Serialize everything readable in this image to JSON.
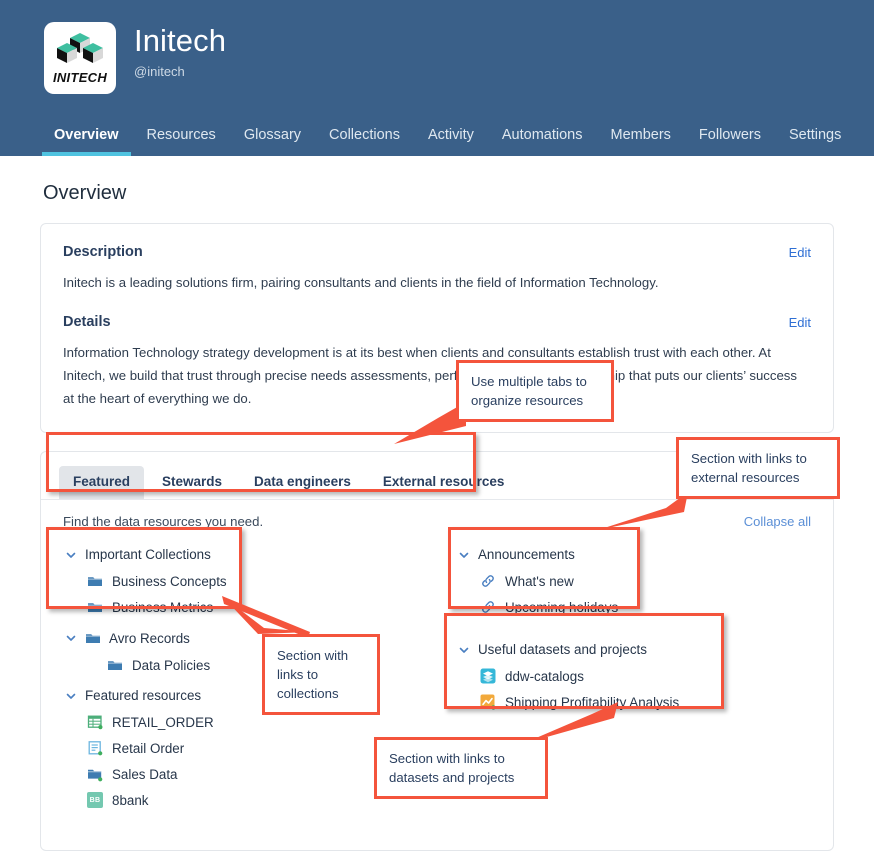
{
  "header": {
    "org_name": "Initech",
    "org_handle": "@initech",
    "logo_word": "INITECH",
    "nav": [
      {
        "label": "Overview",
        "active": true
      },
      {
        "label": "Resources",
        "active": false
      },
      {
        "label": "Glossary",
        "active": false
      },
      {
        "label": "Collections",
        "active": false
      },
      {
        "label": "Activity",
        "active": false
      },
      {
        "label": "Automations",
        "active": false
      },
      {
        "label": "Members",
        "active": false
      },
      {
        "label": "Followers",
        "active": false
      },
      {
        "label": "Settings",
        "active": false
      }
    ]
  },
  "page": {
    "title": "Overview"
  },
  "description": {
    "heading": "Description",
    "edit_label": "Edit",
    "body": "Initech is a leading solutions firm, pairing consultants and clients in the field of Information Technology."
  },
  "details": {
    "heading": "Details",
    "edit_label": "Edit",
    "body": "Information Technology strategy development is at its best when clients and consultants establish trust with each other. At Initech, we build that trust through precise needs assessments, performance in tu                        nd partnership that puts our clients’ success at the heart of everything we do."
  },
  "resources": {
    "tabs": [
      {
        "label": "Featured",
        "active": true
      },
      {
        "label": "Stewards",
        "active": false
      },
      {
        "label": "Data engineers",
        "active": false
      },
      {
        "label": "External resources",
        "active": false
      }
    ],
    "find_text": "Find the data resources you need.",
    "collapse_label": "Collapse all",
    "left_groups": [
      {
        "title": "Important Collections",
        "icon": "chevron-down-icon",
        "has_group_icon": false,
        "items": [
          {
            "label": "Business Concepts",
            "icon": "folder-icon"
          },
          {
            "label": "Business Metrics",
            "icon": "folder-icon"
          }
        ]
      },
      {
        "title": "Avro Records",
        "icon": "chevron-down-icon",
        "has_group_icon": true,
        "items": [
          {
            "label": "Data Policies",
            "icon": "folder-icon"
          }
        ]
      },
      {
        "title": "Featured resources",
        "icon": "chevron-down-icon",
        "has_group_icon": false,
        "items": [
          {
            "label": "RETAIL_ORDER",
            "icon": "table-icon"
          },
          {
            "label": "Retail Order",
            "icon": "document-icon"
          },
          {
            "label": "Sales Data",
            "icon": "folder-icon"
          },
          {
            "label": "8bank",
            "icon": "bb-badge-icon"
          }
        ]
      }
    ],
    "right_groups": [
      {
        "title": "Announcements",
        "icon": "chevron-down-icon",
        "items": [
          {
            "label": "What's new",
            "icon": "link-icon"
          },
          {
            "label": "Upcoming holidays",
            "icon": "link-icon"
          }
        ]
      },
      {
        "title": "Useful datasets and projects",
        "icon": "chevron-down-icon",
        "items": [
          {
            "label": "ddw-catalogs",
            "icon": "layers-icon"
          },
          {
            "label": "Shipping Profitability Analysis",
            "icon": "chart-icon"
          }
        ]
      }
    ]
  },
  "callouts": {
    "tabs": "Use multiple tabs to organize resources",
    "external": "Section with links to external resources",
    "collections": "Section with links to collections",
    "datasets": "Section with links to datasets and projects"
  },
  "colors": {
    "header_blue": "#3a6089",
    "accent_cyan": "#4fc3e0",
    "link_blue": "#2e6fd4",
    "annotation_red": "#f4543c",
    "folder_blue": "#3e7cb1",
    "table_green": "#4cae7a",
    "badge_teal": "#74c8b0",
    "layers_cyan": "#35b7d8",
    "chart_orange": "#f2a93b"
  }
}
